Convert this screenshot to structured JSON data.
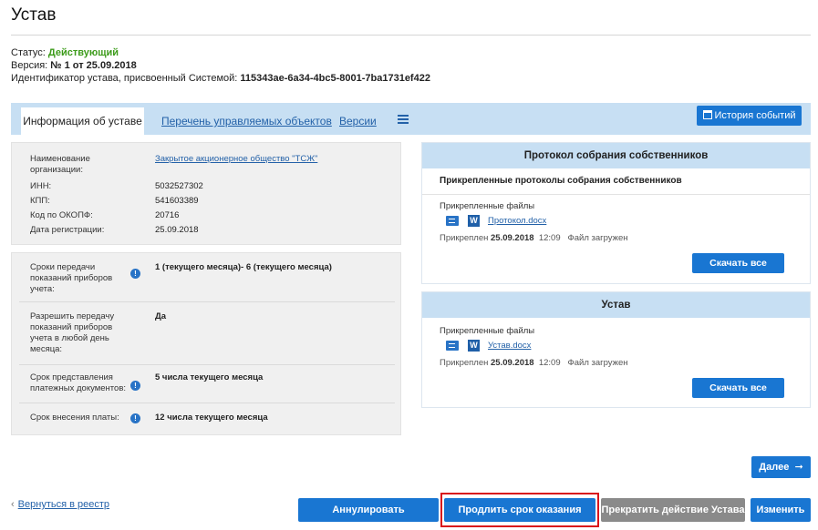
{
  "page": {
    "title": "Устав"
  },
  "meta": {
    "status_label": "Статус:",
    "status_value": "Действующий",
    "version_label": "Версия:",
    "version_value": "№ 1 от 25.09.2018",
    "id_label": "Идентификатор устава, присвоенный Системой:",
    "id_value": "115343ae-6a34-4bc5-8001-7ba1731ef422"
  },
  "tabs": [
    {
      "label": "Информация об уставе",
      "active": true
    },
    {
      "label": "Перечень управляемых объектов",
      "active": false
    },
    {
      "label": "Версии",
      "active": false
    }
  ],
  "toolbar": {
    "history_label": "История событий"
  },
  "org": {
    "name_label": "Наименование организации:",
    "name_value": "Закрытое акционерное общество \"ТСЖ\"",
    "inn_label": "ИНН:",
    "inn_value": "5032527302",
    "kpp_label": "КПП:",
    "kpp_value": "541603389",
    "okopf_label": "Код по ОКОПФ:",
    "okopf_value": "20716",
    "reg_label": "Дата регистрации:",
    "reg_value": "25.09.2018"
  },
  "terms": [
    {
      "label": "Сроки передачи показаний приборов учета:",
      "value": "1 (текущего месяца)- 6 (текущего месяца)",
      "info": true
    },
    {
      "label": "Разрешить передачу показаний приборов учета в любой день месяца:",
      "value": "Да",
      "info": false
    },
    {
      "label": "Срок представления платежных документов:",
      "value": "5 числа текущего месяца",
      "info": true
    },
    {
      "label": "Срок внесения платы:",
      "value": "12 числа текущего месяца",
      "info": true
    }
  ],
  "protocol_card": {
    "title": "Протокол собрания собственников",
    "subtitle": "Прикрепленные протоколы собрания собственников",
    "attached_label": "Прикрепленные файлы",
    "file_name": "Протокол.docx",
    "attached_prefix": "Прикреплен",
    "attached_date": "25.09.2018",
    "attached_time": "12:09",
    "file_status": "Файл загружен",
    "download_label": "Скачать все"
  },
  "charter_card": {
    "title": "Устав",
    "attached_label": "Прикрепленные файлы",
    "file_name": "Устав.docx",
    "attached_prefix": "Прикреплен",
    "attached_date": "25.09.2018",
    "attached_time": "12:09",
    "file_status": "Файл загружен",
    "download_label": "Скачать все"
  },
  "footer": {
    "next_label": "Далее",
    "back_label": "Вернуться в реестр",
    "annul_label": "Аннулировать информацию",
    "extend_label": "Продлить срок оказания услуг",
    "stop_label": "Прекратить действие Устава",
    "edit_label": "Изменить"
  },
  "colors": {
    "accent": "#1976d2",
    "tab_bar": "#c7dff3",
    "status_green": "#3c9b1a",
    "highlight_red": "#d9141b",
    "disabled_gray": "#8a8a8a"
  },
  "icons": [
    "calendar-icon",
    "menu-icon",
    "info-icon",
    "signature-icon",
    "word-icon",
    "arrow-right-icon",
    "chevron-left-icon"
  ]
}
